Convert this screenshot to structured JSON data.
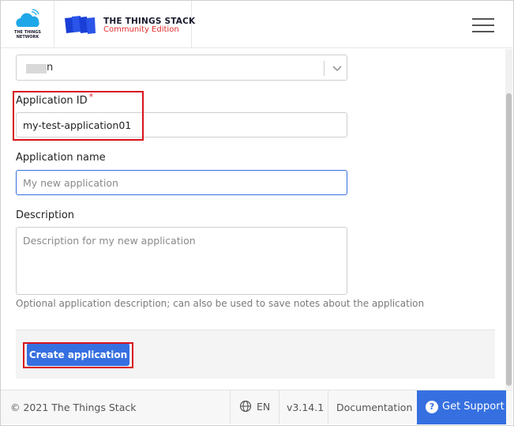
{
  "header": {
    "tti_logo_text": [
      "THE THINGS",
      "NETWORK"
    ],
    "stack_title": "THE THINGS STACK",
    "stack_edition": "Community Edition"
  },
  "form": {
    "owner_select_value": "n",
    "application_id": {
      "label": "Application ID",
      "required_mark": "*",
      "value": "my-test-application01"
    },
    "application_name": {
      "label": "Application name",
      "placeholder": "My new application",
      "value": ""
    },
    "description": {
      "label": "Description",
      "placeholder": "Description for my new application",
      "help": "Optional application description; can also be used to save notes about the application"
    },
    "submit_label": "Create application"
  },
  "footer": {
    "copyright": "© 2021 The Things Stack",
    "language": "EN",
    "version": "v3.14.1",
    "docs": "Documentation",
    "support": "Get Support"
  },
  "colors": {
    "primary": "#3670e0",
    "accent_red": "#e42c2c",
    "highlight_box": "#d8121c"
  },
  "icons": [
    "tti-cloud-logo",
    "stack-logo",
    "hamburger-menu-icon",
    "chevron-down-icon",
    "globe-icon",
    "question-icon"
  ]
}
